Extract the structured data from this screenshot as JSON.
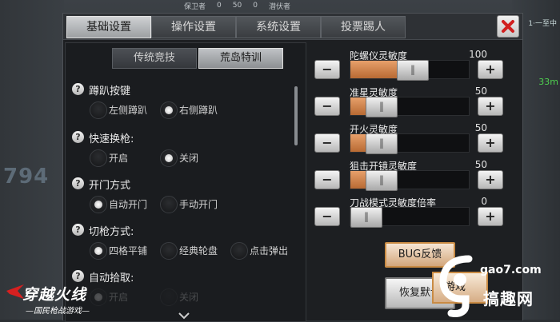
{
  "hud": {
    "left_label": "保卫者",
    "left_score": "0",
    "center": "50",
    "right_score": "0",
    "right_label": "潜伏者"
  },
  "background": {
    "big_number": "794",
    "corner_text": "1·一至中",
    "right_text": "33m"
  },
  "main_tabs": [
    {
      "label": "基础设置",
      "active": true
    },
    {
      "label": "操作设置",
      "active": false
    },
    {
      "label": "系统设置",
      "active": false
    },
    {
      "label": "投票踢人",
      "active": false
    }
  ],
  "sub_tabs": [
    {
      "label": "传统竞技",
      "active": false
    },
    {
      "label": "荒岛特训",
      "active": true
    }
  ],
  "settings": [
    {
      "title": "蹲趴按键",
      "options": [
        {
          "label": "左侧蹲趴",
          "selected": false
        },
        {
          "label": "右侧蹲趴",
          "selected": true
        }
      ]
    },
    {
      "title": "快速换枪:",
      "options": [
        {
          "label": "开启",
          "selected": false
        },
        {
          "label": "关闭",
          "selected": true
        }
      ]
    },
    {
      "title": "开门方式",
      "options": [
        {
          "label": "自动开门",
          "selected": true
        },
        {
          "label": "手动开门",
          "selected": false
        }
      ]
    },
    {
      "title": "切枪方式:",
      "options": [
        {
          "label": "四格平铺",
          "selected": true
        },
        {
          "label": "经典轮盘",
          "selected": false
        },
        {
          "label": "点击弹出",
          "selected": false
        }
      ]
    },
    {
      "title": "自动拾取:",
      "options": [
        {
          "label": "开启",
          "selected": true
        },
        {
          "label": "关闭",
          "selected": false
        }
      ]
    }
  ],
  "sliders": [
    {
      "label": "陀螺仪灵敏度",
      "value": "100",
      "fill_pct": 52
    },
    {
      "label": "准星灵敏度",
      "value": "50",
      "fill_pct": 26
    },
    {
      "label": "开火灵敏度",
      "value": "50",
      "fill_pct": 26
    },
    {
      "label": "狙击开镜灵敏度",
      "value": "50",
      "fill_pct": 26
    },
    {
      "label": "刀战模式灵敏度倍率",
      "value": "0",
      "fill_pct": 0
    }
  ],
  "buttons": {
    "bug": "BUG反馈",
    "reset": "恢复默认",
    "peek": "游戏"
  },
  "logo": {
    "main": "穿越火线",
    "sub": "—国民枪战游戏—"
  },
  "watermark": {
    "site": "gao7.com",
    "name": "搞趣网"
  },
  "colors": {
    "accent": "#d8894f",
    "panel": "#1d1f22"
  }
}
